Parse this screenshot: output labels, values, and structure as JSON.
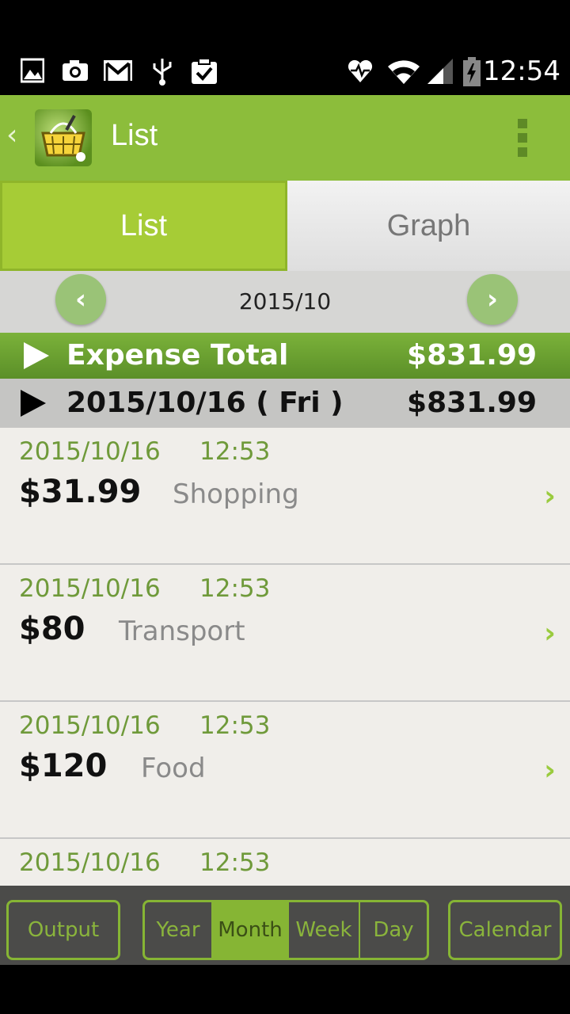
{
  "status_bar": {
    "time": "12:54",
    "icons": [
      "image-icon",
      "camera-icon",
      "gmail-icon",
      "usb-icon",
      "clipboard-check-icon",
      "heart-monitor-icon",
      "wifi-icon",
      "signal-icon",
      "battery-icon"
    ]
  },
  "action_bar": {
    "title": "List",
    "back_glyph": "‹"
  },
  "tabs": [
    {
      "label": "List",
      "active": true
    },
    {
      "label": "Graph",
      "active": false
    }
  ],
  "month_nav": {
    "label": "2015/10",
    "prev_glyph": "‹",
    "next_glyph": "›"
  },
  "expense_total": {
    "label": "Expense Total",
    "amount": "$831.99"
  },
  "date_group": {
    "label": "2015/10/16 ( Fri )",
    "amount": "$831.99"
  },
  "items": [
    {
      "date": "2015/10/16",
      "time": "12:53",
      "amount": "$31.99",
      "category": "Shopping"
    },
    {
      "date": "2015/10/16",
      "time": "12:53",
      "amount": "$80",
      "category": "Transport"
    },
    {
      "date": "2015/10/16",
      "time": "12:53",
      "amount": "$120",
      "category": "Food"
    },
    {
      "date": "2015/10/16",
      "time": "12:53",
      "amount": "",
      "category": ""
    }
  ],
  "chevron_glyph": "›",
  "bottom_bar": {
    "output": "Output",
    "calendar": "Calendar",
    "period": [
      {
        "label": "Year",
        "active": false
      },
      {
        "label": "Month",
        "active": true
      },
      {
        "label": "Week",
        "active": false
      },
      {
        "label": "Day",
        "active": false
      }
    ]
  },
  "colors": {
    "accent": "#8cbd3b",
    "tab_active": "#a6cc36",
    "item_date": "#6f9a3a",
    "toolbar_bg": "#4b4b49"
  }
}
